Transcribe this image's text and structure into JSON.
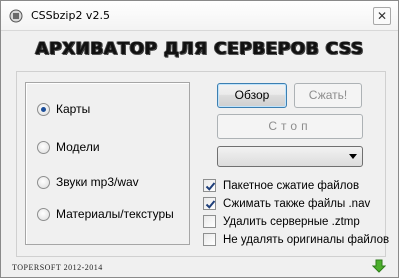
{
  "window": {
    "title": "CSSbzip2 v2.5",
    "close_symbol": "✕"
  },
  "banner": {
    "text": "АРХИВАТОР ДЛЯ СЕРВЕРОВ CSS"
  },
  "radio_group": {
    "options": [
      {
        "label": "Карты",
        "checked": true
      },
      {
        "label": "Модели",
        "checked": false
      },
      {
        "label": "Звуки mp3/wav",
        "checked": false
      },
      {
        "label": "Материалы/текстуры",
        "checked": false
      }
    ]
  },
  "buttons": {
    "browse": "Обзор",
    "compress": "Сжать!",
    "stop": "Стоп"
  },
  "combo": {
    "value": ""
  },
  "checkboxes": [
    {
      "label": "Пакетное сжатие файлов",
      "checked": true
    },
    {
      "label": "Сжимать также файлы .nav",
      "checked": true
    },
    {
      "label": "Удалить серверные .ztmp",
      "checked": false
    },
    {
      "label": "Не удалять оригиналы файлов",
      "checked": false
    }
  ],
  "footer": {
    "copyright": "TOPERSOFT 2012-2014"
  },
  "icons": {
    "app": "app-icon",
    "status": "green-down-arrow-icon"
  },
  "colors": {
    "window_bg": "#f0f0f0",
    "radio_dot": "#1d4f9a",
    "arrow_green": "#4caf2c"
  }
}
